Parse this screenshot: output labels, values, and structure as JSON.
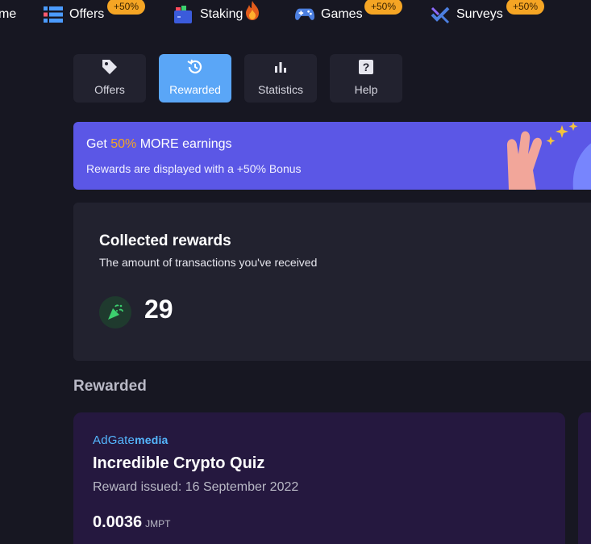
{
  "topnav": {
    "items": [
      {
        "label": "me",
        "icon": "home-icon"
      },
      {
        "label": "Offers",
        "icon": "list-icon",
        "badge": "+50%"
      },
      {
        "label": "Staking",
        "icon": "wallet-icon",
        "extra_icon": "fire-icon"
      },
      {
        "label": "Games",
        "icon": "gamepad-icon",
        "badge": "+50%"
      },
      {
        "label": "Surveys",
        "icon": "survey-icon",
        "badge": "+50%"
      }
    ]
  },
  "tabs": [
    {
      "label": "Offers",
      "icon": "tag-icon",
      "active": false
    },
    {
      "label": "Rewarded",
      "icon": "history-icon",
      "active": true
    },
    {
      "label": "Statistics",
      "icon": "bar-chart-icon",
      "active": false
    },
    {
      "label": "Help",
      "icon": "question-icon",
      "active": false
    }
  ],
  "banner": {
    "title_prefix": "Get ",
    "title_accent": "50%",
    "title_suffix": " MORE earnings",
    "subtitle": "Rewards are displayed with a +50% Bonus"
  },
  "collected": {
    "title": "Collected rewards",
    "subtitle": "The amount of transactions you've received",
    "count": "29",
    "icon": "party-popper-icon"
  },
  "rewarded_section": {
    "title": "Rewarded"
  },
  "rewards": [
    {
      "provider_ad": "Ad",
      "provider_gate": "Gate",
      "provider_media": "media",
      "title": "Incredible Crypto Quiz",
      "date": "Reward issued: 16 September 2022",
      "amount": "0.0036",
      "unit": "JMPT"
    }
  ],
  "colors": {
    "background": "#171722",
    "card": "#22222f",
    "accent_blue": "#5aa6f7",
    "banner": "#5b57e6",
    "badge": "#f5a524",
    "reward_card": "#25183f"
  }
}
